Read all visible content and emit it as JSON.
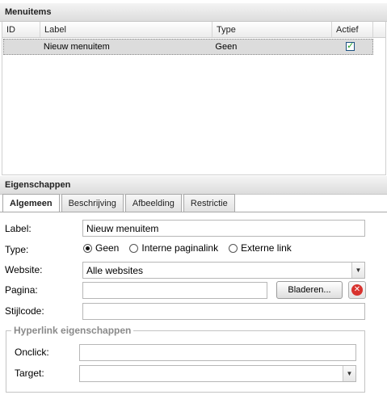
{
  "menuitems": {
    "title": "Menuitems",
    "columns": [
      "ID",
      "Label",
      "Type",
      "Actief"
    ],
    "rows": [
      {
        "id": "",
        "label": "Nieuw menuitem",
        "type": "Geen",
        "actief": true
      }
    ]
  },
  "eigenschappen": {
    "title": "Eigenschappen",
    "tabs": [
      "Algemeen",
      "Beschrijving",
      "Afbeelding",
      "Restrictie"
    ],
    "active_tab": "Algemeen",
    "form": {
      "label_label": "Label:",
      "label_value": "Nieuw menuitem",
      "type_label": "Type:",
      "type_options": [
        "Geen",
        "Interne paginalink",
        "Externe link"
      ],
      "type_selected": "Geen",
      "website_label": "Website:",
      "website_value": "Alle websites",
      "pagina_label": "Pagina:",
      "pagina_value": "",
      "browse_label": "Bladeren...",
      "stijlcode_label": "Stijlcode:",
      "stijlcode_value": ""
    },
    "hyperlink": {
      "legend": "Hyperlink eigenschappen",
      "onclick_label": "Onclick:",
      "onclick_value": "",
      "target_label": "Target:",
      "target_value": ""
    }
  },
  "icons": {
    "dropdown": "chevron-down-icon",
    "clear": "clear-red-icon",
    "checkbox": "checkbox-checked-icon"
  },
  "colors": {
    "header_bg": "#dcdcdc",
    "selected_row": "#dcdcdc",
    "clear_icon": "#d8322e",
    "legend_text": "#8a8a8a"
  }
}
